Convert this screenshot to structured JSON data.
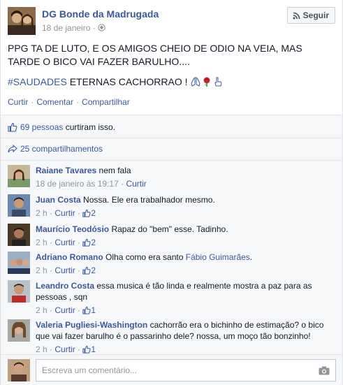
{
  "page": {
    "name": "DG Bonde da Madrugada",
    "date": "18 de janeiro",
    "follow_label": "Seguir"
  },
  "post": {
    "line1": "PPG TA DE LUTO, E OS AMIGOS CHEIO DE ODIO NA VEIA, MAS TARDE O BICO VAI FAZER BARULHO....",
    "hashtag": "#SAUDADES",
    "line2_rest": " ETERNAS CACHORRAO ! "
  },
  "actions": {
    "like": "Curtir",
    "comment": "Comentar",
    "share": "Compartilhar",
    "separator": "·"
  },
  "likes": {
    "count_link": "69 pessoas",
    "text": " curtiram isso."
  },
  "shares": {
    "text": "25 compartilhamentos"
  },
  "comments": [
    {
      "author": "Raiane Tavares",
      "text": "nem fala",
      "meta_time": "18 de janeiro às 19:17",
      "like_label": "Curtir",
      "likes": ""
    },
    {
      "author": "Juan Costa",
      "text": "Nossa. Ele era trabalhador mesmo.",
      "meta_time": "2 h",
      "like_label": "Curtir",
      "likes": "2"
    },
    {
      "author": "Maurício Teodósio",
      "text": "Rapaz do \"bem\" esse. Tadinho.",
      "meta_time": "2 h",
      "like_label": "Curtir",
      "likes": "2"
    },
    {
      "author": "Adriano Romano",
      "text": "Olha como era santo ",
      "mention": "Fábio Guimarães",
      "text_after": ".",
      "meta_time": "2 h",
      "like_label": "Curtir",
      "likes": "2"
    },
    {
      "author": "Leandro Costa",
      "text": "essa musica é tão linda e realmente mostra a paz para as pessoas , sqn",
      "meta_time": "2 h",
      "like_label": "Curtir",
      "likes": "1"
    },
    {
      "author": "Valeria Pugliesi-Washington",
      "text": "cachorrão era o bichinho de estimação? o bico que vai fazer barulho é o passarinho dele? nossa, um moço tão bonzinho!",
      "meta_time": "2 h",
      "like_label": "Curtir",
      "likes": "1"
    }
  ],
  "composer": {
    "placeholder": "Escreva um comentário..."
  },
  "colors": {
    "link": "#3b5998",
    "meta": "#90949c",
    "background_gray": "#f6f7f9"
  }
}
